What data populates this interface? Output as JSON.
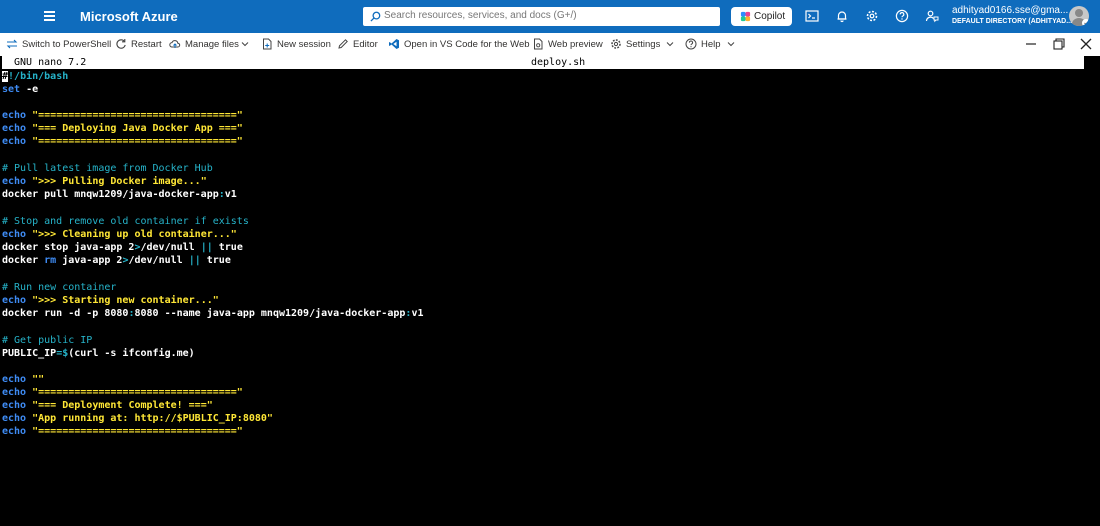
{
  "azure": {
    "brand": "Microsoft Azure",
    "search_placeholder": "Search resources, services, and docs (G+/)",
    "copilot_label": "Copilot",
    "account_email": "adhityad0166.sse@gma...",
    "account_directory": "DEFAULT DIRECTORY (ADHITYAD..."
  },
  "shell_toolbar": {
    "switch": "Switch to PowerShell",
    "restart": "Restart",
    "manage_files": "Manage files",
    "new_session": "New session",
    "editor": "Editor",
    "vscode": "Open in VS Code for the Web",
    "web_preview": "Web preview",
    "settings": "Settings",
    "help": "Help"
  },
  "nano": {
    "version": "GNU nano 7.2",
    "filename": "deploy.sh"
  },
  "code": {
    "l1_cursor": "#",
    "l1_rest": "!/bin/bash",
    "l2_kw": "set",
    "l2_rest": " -e",
    "l4_kw": "echo",
    "l4_str": " \"=================================\"",
    "l5_kw": "echo",
    "l5_str": " \"=== Deploying Java Docker App ===\"",
    "l6_kw": "echo",
    "l6_str": " \"=================================\"",
    "l8_cmt": "# Pull latest image from Docker Hub",
    "l9_kw": "echo",
    "l9_str": " \">>> Pulling Docker image...\"",
    "l10_a": "docker pull mnqw1209/java-docker-app",
    "l10_op": ":",
    "l10_b": "v1",
    "l12_cmt": "# Stop and remove old container if exists",
    "l13_kw": "echo",
    "l13_str": " \">>> Cleaning up old container...\"",
    "l14_a": "docker stop java-app 2",
    "l14_op1": ">",
    "l14_b": "/dev/null ",
    "l14_op2": "||",
    "l14_c": " true",
    "l15_a": "docker ",
    "l15_kw": "rm",
    "l15_b": " java-app 2",
    "l15_op1": ">",
    "l15_c": "/dev/null ",
    "l15_op2": "||",
    "l15_d": " true",
    "l17_cmt": "# Run new container",
    "l18_kw": "echo",
    "l18_str": " \">>> Starting new container...\"",
    "l19_a": "docker run -d -p 8080",
    "l19_op1": ":",
    "l19_b": "8080 --name java-app mnqw1209/java-docker-app",
    "l19_op2": ":",
    "l19_c": "v1",
    "l21_cmt": "# Get public IP",
    "l22_a": "PUBLIC_IP",
    "l22_op": "=$",
    "l22_b": "(curl -s ifconfig.me)",
    "l24_kw": "echo",
    "l24_str": " \"\"",
    "l25_kw": "echo",
    "l25_str": " \"=================================\"",
    "l26_kw": "echo",
    "l26_str": " \"=== Deployment Complete! ===\"",
    "l27_kw": "echo",
    "l27_str": " \"App running at: http://$PUBLIC_IP:8080\"",
    "l28_kw": "echo",
    "l28_str": " \"=================================\""
  },
  "colors": {
    "azure_blue": "#0f6cbd",
    "comment": "#26b3c9",
    "keyword": "#3f8cf5",
    "string": "#ffe736"
  }
}
